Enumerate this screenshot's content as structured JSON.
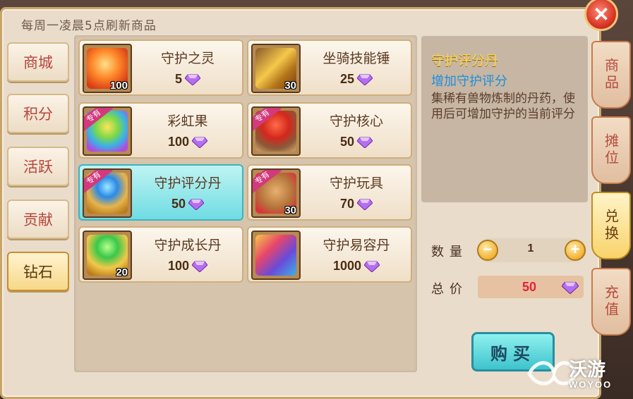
{
  "header": {
    "refresh_note": "每周一凌晨5点刷新商品"
  },
  "categories": [
    {
      "label": "商城",
      "active": false
    },
    {
      "label": "积分",
      "active": false
    },
    {
      "label": "活跃",
      "active": false
    },
    {
      "label": "贡献",
      "active": false
    },
    {
      "label": "钻石",
      "active": true
    }
  ],
  "items": [
    {
      "name": "守护之灵",
      "price": "5",
      "quantity": "100",
      "exclusive": false,
      "selected": false,
      "icon": "orange-spirit-orb-icon"
    },
    {
      "name": "坐骑技能锤",
      "price": "25",
      "quantity": "30",
      "exclusive": false,
      "selected": false,
      "icon": "golden-hammer-icon"
    },
    {
      "name": "彩虹果",
      "price": "100",
      "quantity": "",
      "exclusive": true,
      "selected": false,
      "icon": "rainbow-fruit-icon"
    },
    {
      "name": "守护核心",
      "price": "50",
      "quantity": "",
      "exclusive": true,
      "selected": false,
      "icon": "red-core-chest-icon"
    },
    {
      "name": "守护评分丹",
      "price": "50",
      "quantity": "",
      "exclusive": true,
      "selected": true,
      "icon": "blue-pill-lotus-icon"
    },
    {
      "name": "守护玩具",
      "price": "70",
      "quantity": "30",
      "exclusive": true,
      "selected": false,
      "icon": "teddy-bear-icon"
    },
    {
      "name": "守护成长丹",
      "price": "100",
      "quantity": "20",
      "exclusive": false,
      "selected": false,
      "icon": "green-pill-gold-base-icon"
    },
    {
      "name": "守护易容丹",
      "price": "1000",
      "quantity": "",
      "exclusive": false,
      "selected": false,
      "icon": "rainbow-mask-icon"
    }
  ],
  "exclusive_badge": "专有",
  "currency_icon": "purple-diamond-icon",
  "detail": {
    "title": "守护评分丹",
    "effect": "增加守护评分",
    "description": "集稀有兽物炼制的丹药，使用后可增加守护的当前评分"
  },
  "purchase": {
    "quantity_label": "数量",
    "quantity": "1",
    "total_label": "总价",
    "total": "50",
    "buy_label": "购买"
  },
  "side_tabs": [
    {
      "label": "商品",
      "active": false
    },
    {
      "label": "摊位",
      "active": false
    },
    {
      "label": "兑换",
      "active": true
    },
    {
      "label": "充值",
      "active": false
    }
  ],
  "watermark": {
    "text": "沃游",
    "sub": "WOYOO"
  },
  "colors": {
    "selected_item": "#6fdce3",
    "detail_title": "#ffd84a",
    "detail_effect": "#1f8edb",
    "total_price": "#e2233a",
    "buy_button": "#3ec3cc"
  }
}
